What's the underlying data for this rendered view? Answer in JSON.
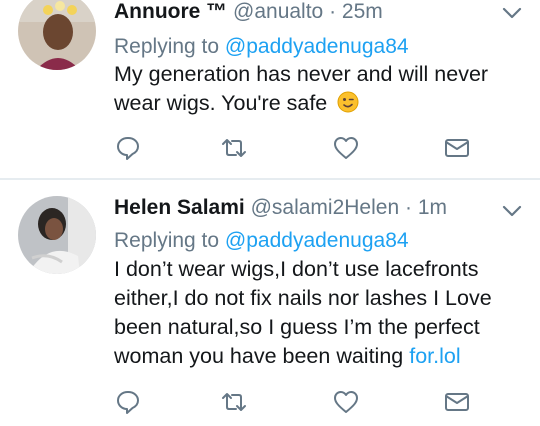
{
  "tweets": [
    {
      "name": "Annuore ™",
      "handle": "@anualto",
      "separator": "·",
      "time": "25m",
      "replying_prefix": "Replying to",
      "replying_to": "@paddyadenuga84",
      "text": "My generation has never and will never wear wigs. You're safe",
      "emoji": "winking-face-emoji"
    },
    {
      "name": "Helen Salami",
      "handle": "@salami2Helen",
      "separator": "·",
      "time": "1m",
      "replying_prefix": "Replying to",
      "replying_to": "@paddyadenuga84",
      "text": "I don’t wear wigs,I don’t use lacefronts either,I do not fix nails nor lashes I Love been natural,so I guess I’m the perfect woman you have been waiting ",
      "link_text": "for.lol"
    }
  ],
  "colors": {
    "text": "#14171a",
    "muted": "#657786",
    "link": "#1da1f2",
    "divider": "#e6ecf0"
  }
}
